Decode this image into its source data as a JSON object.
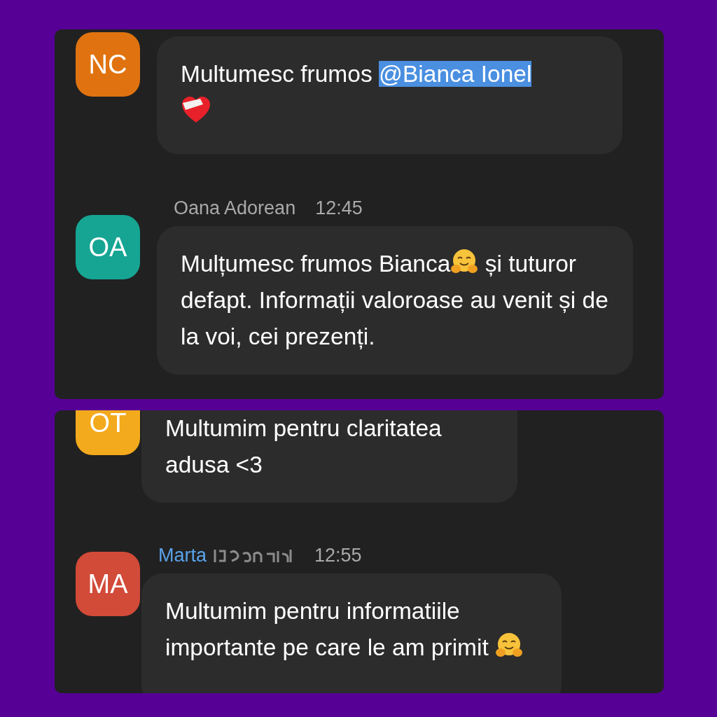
{
  "panels": [
    {
      "messages": [
        {
          "avatar": {
            "initials": "NC",
            "color": "#e07310"
          },
          "parts": [
            {
              "kind": "text",
              "text": "Multumesc frumos "
            },
            {
              "kind": "mention",
              "text": "@Bianca Ionel",
              "selected": true
            },
            {
              "kind": "break"
            },
            {
              "kind": "heart"
            }
          ]
        },
        {
          "author": {
            "name": "Oana Adorean",
            "highlighted": false
          },
          "time": "12:45",
          "avatar": {
            "initials": "OA",
            "color": "#16a593"
          },
          "parts": [
            {
              "kind": "text",
              "text": "Mulțumesc frumos Bianca"
            },
            {
              "kind": "hug"
            },
            {
              "kind": "text",
              "text": " și tuturor defapt. Informații valoroase au venit și de la voi, cei prezenți."
            }
          ]
        }
      ]
    },
    {
      "messages": [
        {
          "avatar": {
            "initials": "OT",
            "color": "#f3aa1c"
          },
          "parts": [
            {
              "kind": "text",
              "text": "Multumim pentru claritatea adusa <3"
            }
          ]
        },
        {
          "author": {
            "name": "Marta",
            "highlighted": true,
            "obscured": true
          },
          "time": "12:55",
          "avatar": {
            "initials": "MA",
            "color": "#d24a38"
          },
          "parts": [
            {
              "kind": "text",
              "text": "Multumim pentru informatiile importante pe care le am primit "
            },
            {
              "kind": "hug"
            }
          ]
        }
      ]
    }
  ]
}
